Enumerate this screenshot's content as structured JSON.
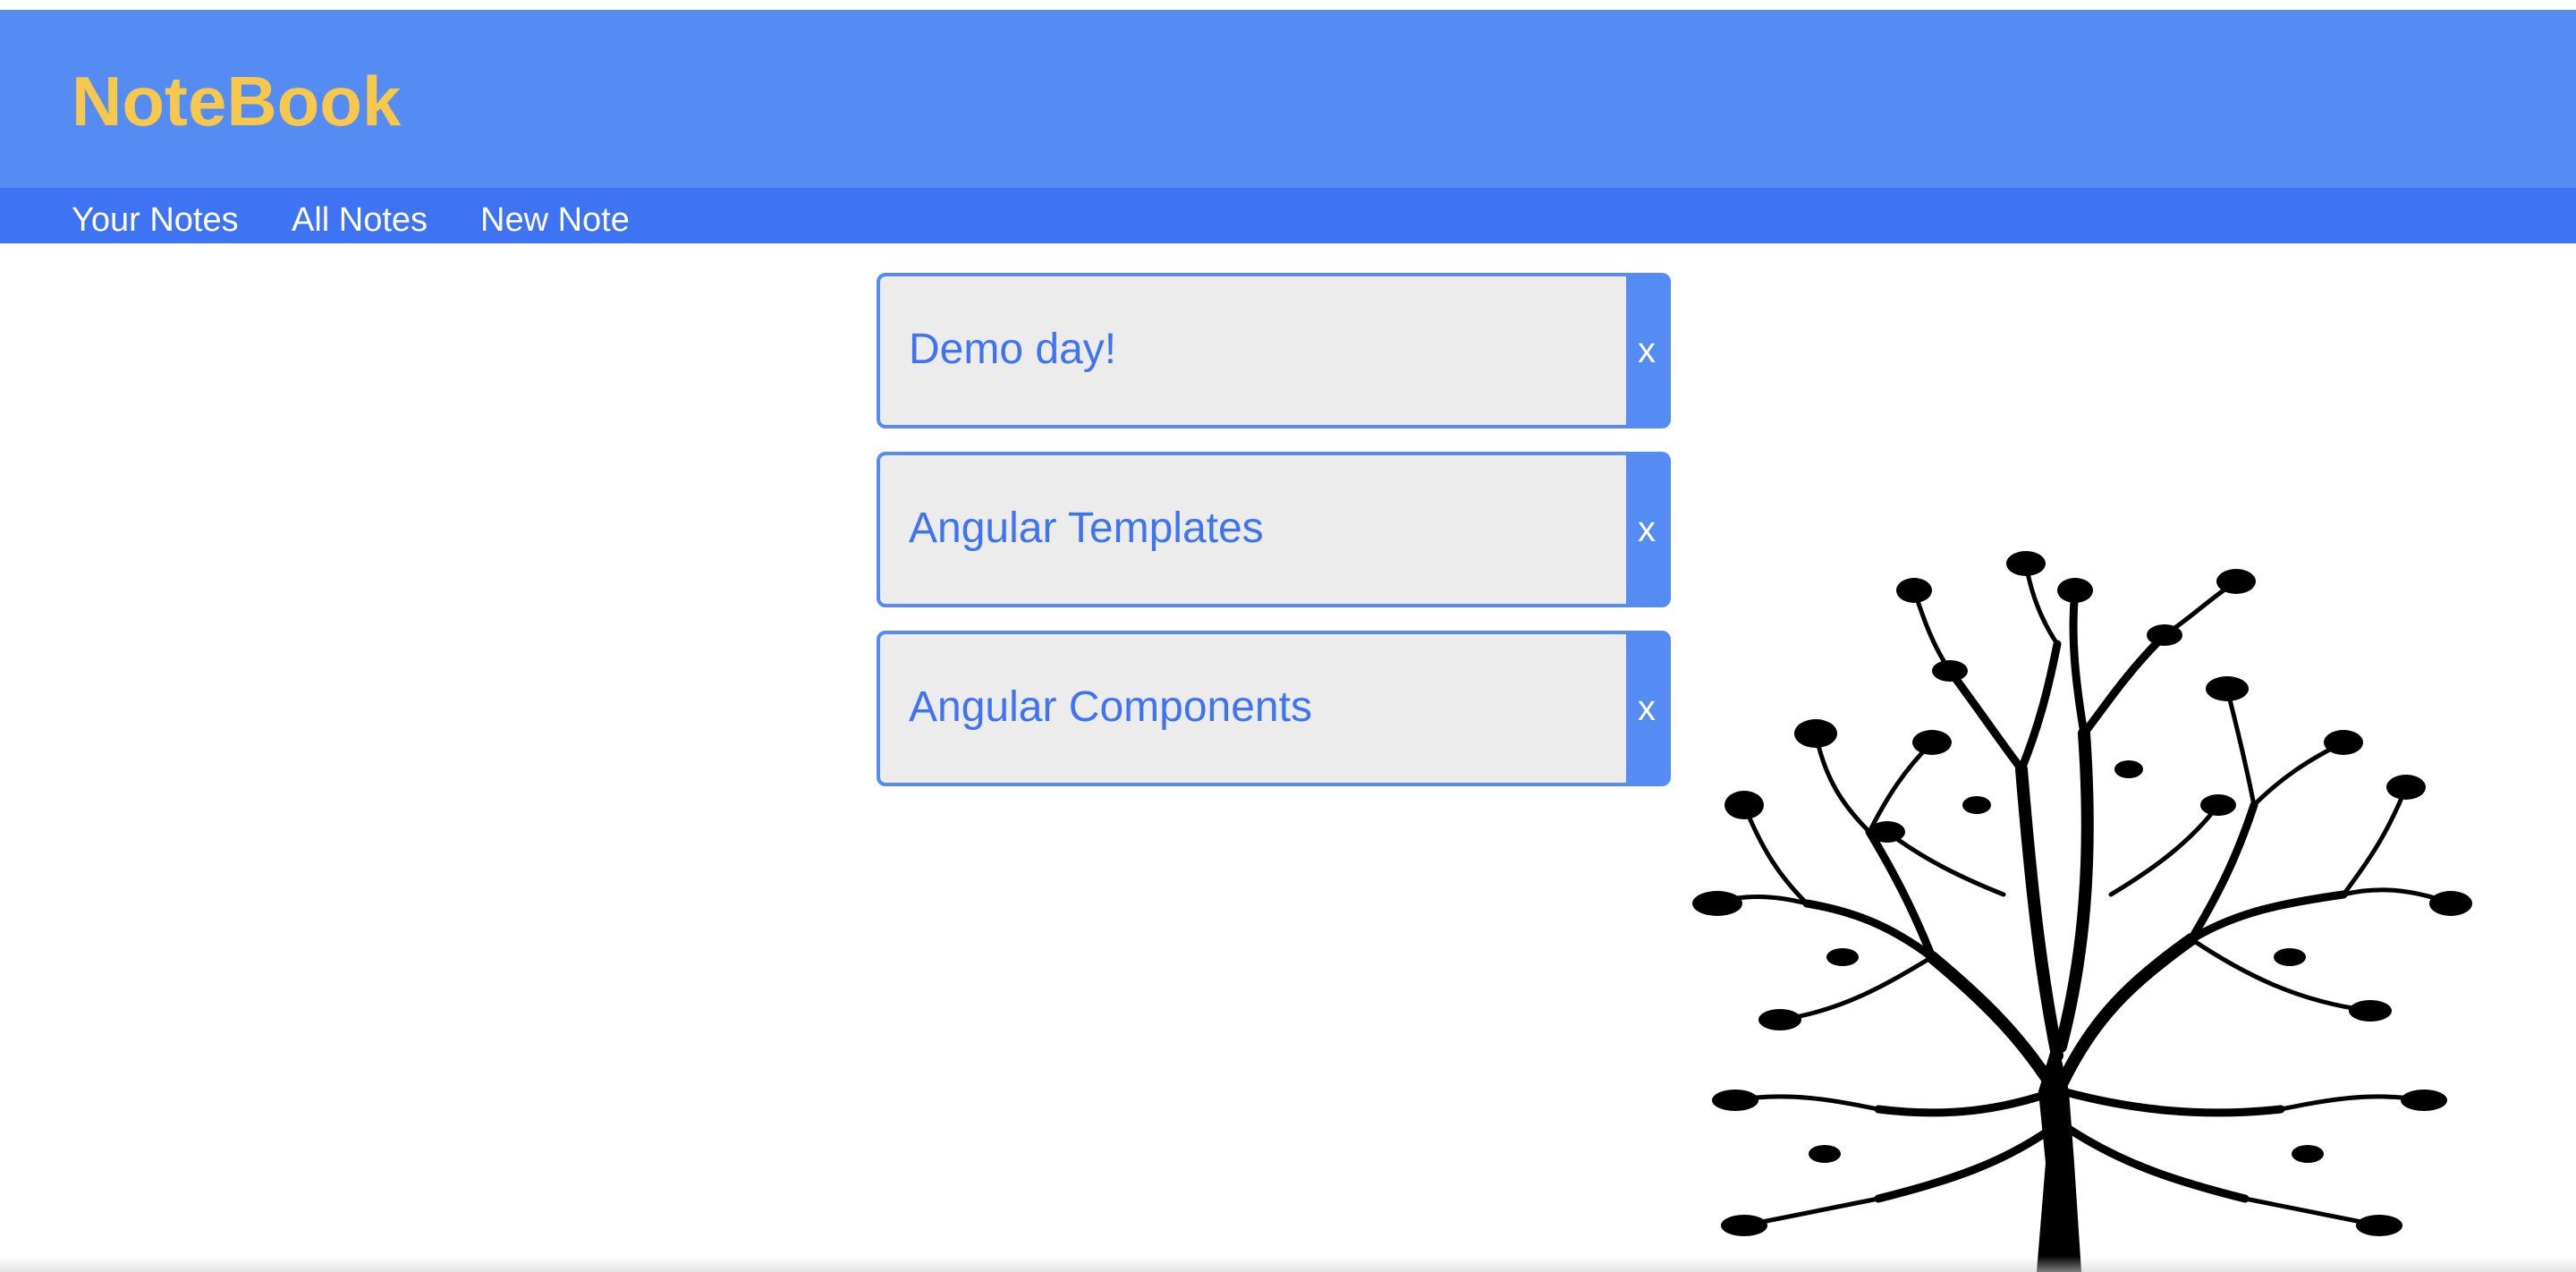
{
  "header": {
    "brand": "NoteBook"
  },
  "nav": {
    "items": [
      {
        "label": "Your Notes"
      },
      {
        "label": "All Notes"
      },
      {
        "label": "New Note"
      }
    ]
  },
  "notes": [
    {
      "title": "Demo day!",
      "delete_label": "x"
    },
    {
      "title": "Angular Templates",
      "delete_label": "x"
    },
    {
      "title": "Angular Components",
      "delete_label": "x"
    }
  ],
  "colors": {
    "header_bg": "#558cf4",
    "nav_bg": "#3e73f4",
    "brand": "#f7c84b",
    "note_bg": "#ececec",
    "note_text": "#3e73f4",
    "note_border": "#558cf4"
  },
  "decor": {
    "tree_icon": "tree-silhouette-icon"
  }
}
